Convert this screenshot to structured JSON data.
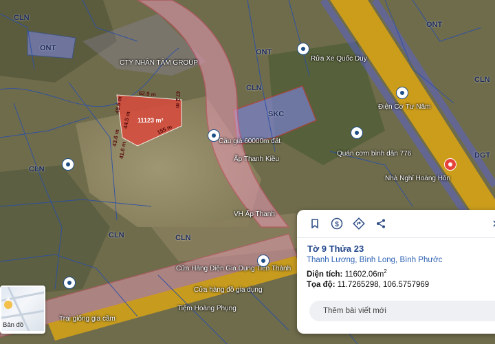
{
  "map": {
    "zone_labels": [
      "ONT",
      "ONT",
      "CLN",
      "CLN",
      "CLN",
      "CLN",
      "CLN",
      "CLN",
      "ONT",
      "SKC",
      "DGT"
    ],
    "poi_labels": [
      "CTY NHÂN TÂM GROUP",
      "Rửa Xe Quốc Duy",
      "Điện Cơ Tư Năm",
      "Quán cơm bình dân 776",
      "Nhà Nghỉ Hoàng Hôn",
      "Cửa Hàng Điện Gia Dụng Tiến Thành",
      "Cửa hàng đồ gia dụng",
      "Trại giống gia cầm",
      "Tiệm Hoàng Phụng",
      "Cầu già 60000m đất",
      "Ấp Thanh Kiều",
      "VH Ấp Thanh"
    ],
    "parcel_dimensions": [
      "62.9 m",
      "47.2 m",
      "48.6 m",
      "44.5 m",
      "43.6 m",
      "41.6 m",
      "155 m"
    ],
    "parcel_area": "11123 m²",
    "colors": {
      "parcel": "#d94a3c",
      "zone_blue": "#7b84d9",
      "road_yellow": "#d6a316",
      "road_pink": "#e79bb5",
      "boundary": "#2b4fa8"
    }
  },
  "panel": {
    "title": "Tờ 9 Thửa 23",
    "address": "Thanh Lương, Bình Long, Bình Phước",
    "area_label": "Diện tích:",
    "area_value": "11602.06m",
    "area_unit_sup": "2",
    "coord_label": "Tọa độ:",
    "coord_value": "11.7265298, 106.5757969",
    "comment_placeholder": "Thêm bài viết mới",
    "icons": [
      "bookmark-icon",
      "dollar-icon",
      "directions-icon",
      "share-icon",
      "close-icon"
    ]
  },
  "basemap_button": {
    "label": "Bản đồ"
  }
}
